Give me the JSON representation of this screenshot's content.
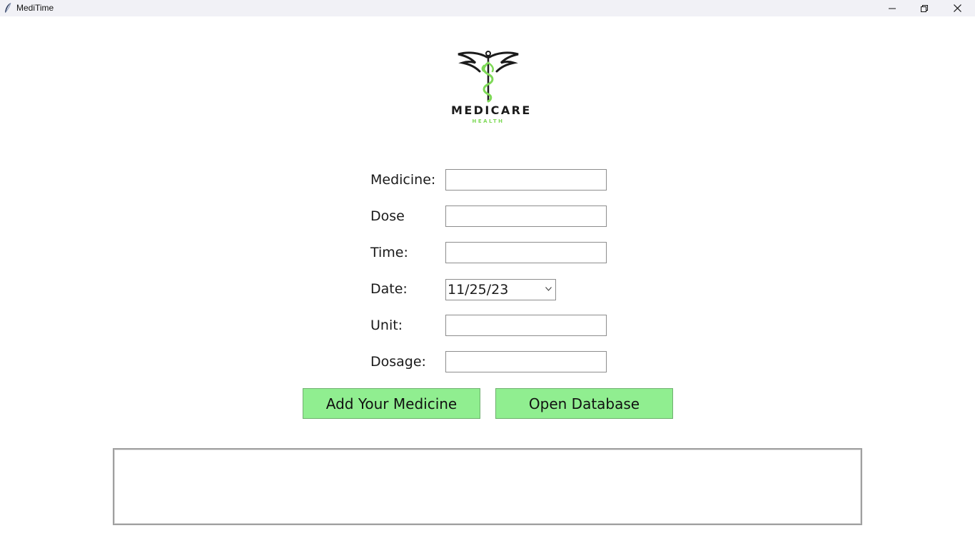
{
  "window": {
    "title": "MediTime",
    "controls": [
      "minimize-icon",
      "restore-icon",
      "close-icon"
    ]
  },
  "logo": {
    "brand": "MEDICARE",
    "sub": "HEALTH",
    "colors": {
      "dark": "#1b1b1b",
      "green": "#7ed957"
    }
  },
  "form": {
    "medicine_label": "Medicine:",
    "medicine_value": "",
    "dose_label": "Dose",
    "dose_value": "",
    "time_label": "Time:",
    "time_value": "",
    "date_label": "Date:",
    "date_value": "11/25/23",
    "unit_label": "Unit:",
    "unit_value": "",
    "dosage_label": "Dosage:",
    "dosage_value": ""
  },
  "buttons": {
    "add_label": "Add Your Medicine",
    "open_label": "Open Database",
    "color": "#90ee90"
  },
  "output": {
    "text": ""
  }
}
